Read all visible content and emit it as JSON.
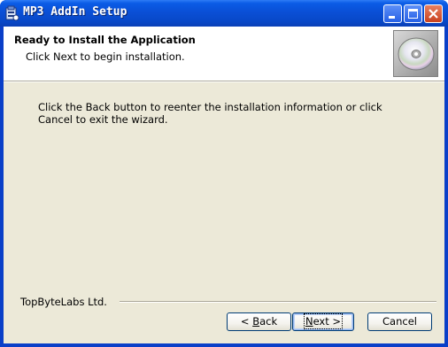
{
  "window": {
    "title": "MP3 AddIn Setup",
    "caption_buttons": [
      "minimize-icon",
      "maximize-icon",
      "close-icon"
    ]
  },
  "header": {
    "title": "Ready to Install the Application",
    "subtitle": "Click Next to begin installation."
  },
  "body": {
    "text": "Click the Back button to reenter the installation information or click Cancel to exit the wizard."
  },
  "footer": {
    "vendor": "TopByteLabs Ltd.",
    "back_pre": "< ",
    "back_accel": "B",
    "back_post": "ack",
    "next_accel": "N",
    "next_post": "ext >",
    "cancel_label": "Cancel"
  },
  "colors": {
    "titlebar": "#0a4fd6",
    "dialog_bg": "#ece9d8",
    "close_button": "#c9411f"
  }
}
